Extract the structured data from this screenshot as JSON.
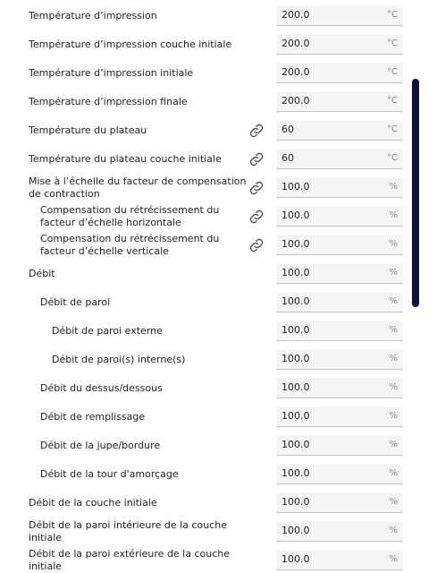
{
  "rows": [
    {
      "label": "Température d’impression",
      "value": "200.0",
      "unit": "°C",
      "indent": 0,
      "link": false
    },
    {
      "label": "Température d’impression couche initiale",
      "value": "200.0",
      "unit": "°C",
      "indent": 0,
      "link": false
    },
    {
      "label": "Température d’impression initiale",
      "value": "200.0",
      "unit": "°C",
      "indent": 0,
      "link": false
    },
    {
      "label": "Température d’impression finale",
      "value": "200.0",
      "unit": "°C",
      "indent": 0,
      "link": false
    },
    {
      "label": "Température du plateau",
      "value": "60",
      "unit": "°C",
      "indent": 0,
      "link": true
    },
    {
      "label": "Température du plateau couche initiale",
      "value": "60",
      "unit": "°C",
      "indent": 0,
      "link": true
    },
    {
      "label": "Mise à l’échelle du facteur de compensation de contraction",
      "value": "100.0",
      "unit": "%",
      "indent": 0,
      "link": true
    },
    {
      "label": "Compensation du rétrécissement du facteur d’échelle horizontale",
      "value": "100.0",
      "unit": "%",
      "indent": 1,
      "link": true
    },
    {
      "label": "Compensation du rétrécissement du facteur d’échelle verticale",
      "value": "100.0",
      "unit": "%",
      "indent": 1,
      "link": true
    },
    {
      "label": "Débit",
      "value": "100.0",
      "unit": "%",
      "indent": 0,
      "link": false
    },
    {
      "label": "Débit de paroi",
      "value": "100.0",
      "unit": "%",
      "indent": 1,
      "link": false
    },
    {
      "label": "Débit de paroi externe",
      "value": "100.0",
      "unit": "%",
      "indent": 2,
      "link": false
    },
    {
      "label": "Débit de paroi(s) interne(s)",
      "value": "100.0",
      "unit": "%",
      "indent": 2,
      "link": false
    },
    {
      "label": "Débit du dessus/dessous",
      "value": "100.0",
      "unit": "%",
      "indent": 1,
      "link": false
    },
    {
      "label": "Débit de remplissage",
      "value": "100.0",
      "unit": "%",
      "indent": 1,
      "link": false
    },
    {
      "label": "Débit de la jupe/bordure",
      "value": "100.0",
      "unit": "%",
      "indent": 1,
      "link": false
    },
    {
      "label": "Débit de la tour d'amorçage",
      "value": "100.0",
      "unit": "%",
      "indent": 1,
      "link": false
    },
    {
      "label": "Débit de la couche initiale",
      "value": "100.0",
      "unit": "%",
      "indent": 0,
      "link": false
    },
    {
      "label": "Débit de la paroi intérieure de la couche initiale",
      "value": "100.0",
      "unit": "%",
      "indent": 0,
      "link": false
    },
    {
      "label": "Débit de la paroi extérieure de la couche initiale",
      "value": "100.0",
      "unit": "%",
      "indent": 0,
      "link": false
    }
  ]
}
